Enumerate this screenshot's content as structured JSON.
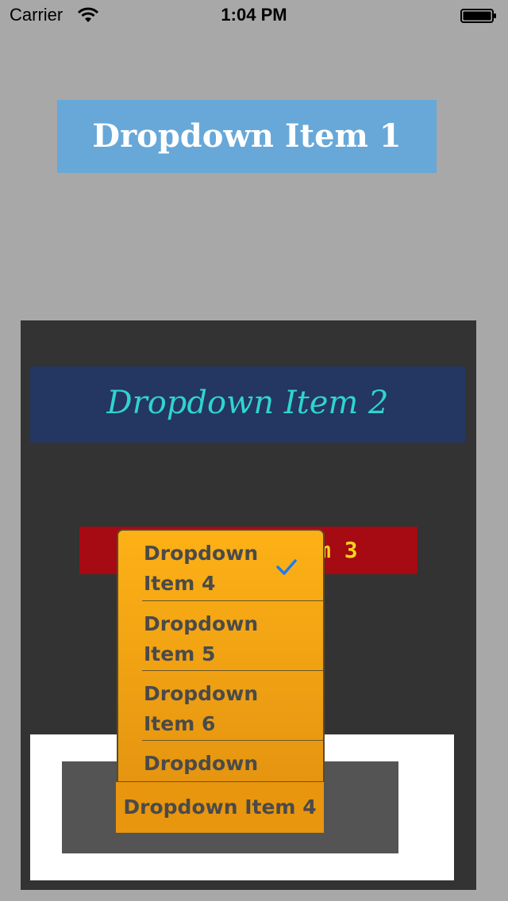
{
  "status_bar": {
    "carrier": "Carrier",
    "time": "1:04 PM",
    "icons": [
      "wifi-icon",
      "battery-icon"
    ]
  },
  "dropdown1": {
    "label": "Dropdown Item 1"
  },
  "dropdown2": {
    "label": "Dropdown Item 2"
  },
  "dropdown3": {
    "label_visible": "m 3"
  },
  "dropdown4": {
    "label": "Dropdown Item 4"
  },
  "menu": {
    "items": [
      {
        "label": "Dropdown Item 4",
        "selected": true
      },
      {
        "label": "Dropdown Item 5",
        "selected": false
      },
      {
        "label": "Dropdown Item 6",
        "selected": false
      },
      {
        "label": "Dropdown",
        "selected": false
      }
    ]
  },
  "colors": {
    "background": "#a8a8a8",
    "dropdown1_bg": "#67a8d8",
    "dropdown2_bg": "#243662",
    "dropdown2_text": "#2fd4d0",
    "dropdown3_bg": "#a60a12",
    "dropdown3_text": "#f6d41c",
    "menu_bg": "#fdb116",
    "checkmark": "#1a7cf0"
  }
}
